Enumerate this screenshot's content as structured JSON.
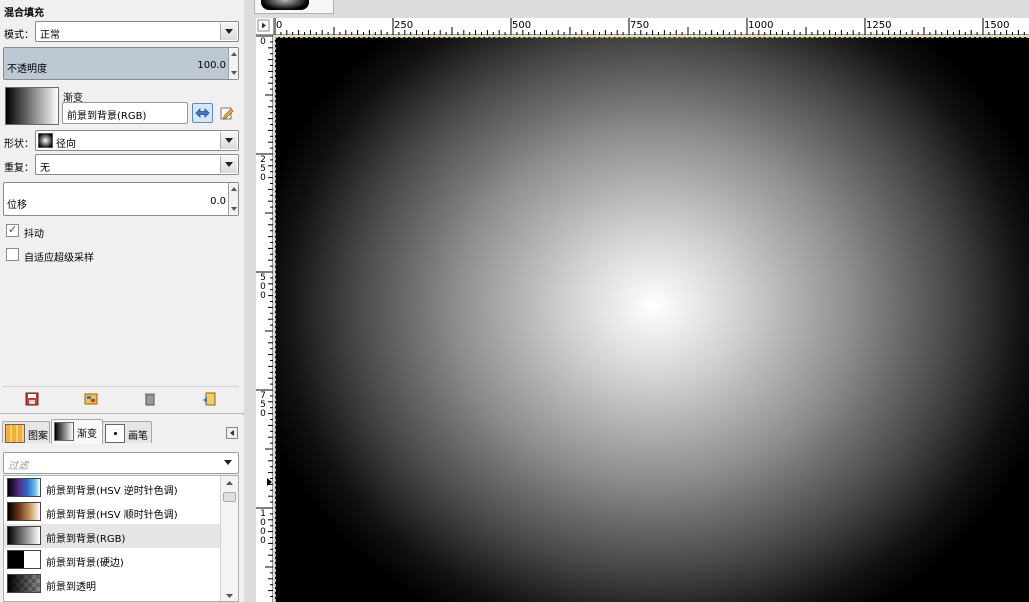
{
  "tool_options": {
    "title": "混合填充",
    "mode_label": "模式：",
    "mode_value": "正常",
    "opacity_label": "不透明度",
    "opacity_value": "100.0",
    "gradient_label": "渐变",
    "gradient_name": "前景到背景(RGB)",
    "shape_label": "形状：",
    "shape_value": "径向",
    "repeat_label": "重复：",
    "repeat_value": "无",
    "offset_label": "位移",
    "offset_value": "0.0",
    "dither_label": "抖动",
    "dither_checked": true,
    "supersample_label": "自适应超级采样",
    "supersample_checked": false
  },
  "resources": {
    "tabs": [
      {
        "label": "图案"
      },
      {
        "label": "渐变"
      },
      {
        "label": "画笔"
      }
    ],
    "filter_placeholder": "过滤",
    "gradients": [
      {
        "name": "前景到背景(HSV 逆时针色调)"
      },
      {
        "name": "前景到背景(HSV 顺时针色调)"
      },
      {
        "name": "前景到背景(RGB)",
        "selected": true
      },
      {
        "name": "前景到背景(硬边)"
      },
      {
        "name": "前景到透明"
      }
    ]
  },
  "image_window": {
    "ruler_h_labels": [
      "0",
      "250",
      "500",
      "750",
      "1000",
      "1250",
      "1500"
    ],
    "ruler_v_labels": [
      "0",
      "250",
      "500",
      "750",
      "1000"
    ]
  },
  "colors": {
    "selection_blue": "#bcc8d3",
    "canvas_bg": "#000000",
    "gradient_center": "#ffffff"
  }
}
